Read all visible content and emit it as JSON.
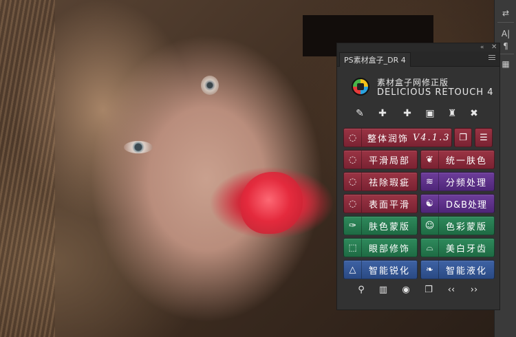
{
  "panel": {
    "tab_title": "PS素材盒子_DR 4",
    "brand_cn": "素材盒子网修正版",
    "brand_en": "DELICIOUS RETOUCH 4",
    "collapse_glyph": "«",
    "close_glyph": "✕"
  },
  "toolbar_icons": [
    "dropper-brush-icon",
    "bandage-icon",
    "bandage-2-icon",
    "chip-icon",
    "stamp-icon",
    "stamp-x-icon"
  ],
  "toolbar_glyphs": [
    "✎",
    "✚",
    "✚",
    "▣",
    "♜",
    "✖"
  ],
  "buttons": {
    "overall_skin": {
      "label": "整体润饰",
      "version": "V4.1.3",
      "icon": "lasso-icon",
      "glyph": "◌"
    },
    "smooth_local": {
      "label": "平滑局部",
      "icon": "lasso-icon",
      "glyph": "◌"
    },
    "unify_skin": {
      "label": "统一肤色",
      "icon": "leaf-icon",
      "glyph": "❦"
    },
    "remove_blemish": {
      "label": "祛除瑕疵",
      "icon": "lasso-icon",
      "glyph": "◌"
    },
    "freq_sep": {
      "label": "分频处理",
      "icon": "wave-icon",
      "glyph": "≋"
    },
    "surface_smooth": {
      "label": "表面平滑",
      "icon": "lasso-icon",
      "glyph": "◌"
    },
    "db_process": {
      "label": "D&B处理",
      "icon": "yin-yang-icon",
      "glyph": "☯"
    },
    "skin_mask": {
      "label": "肤色蒙版",
      "icon": "eyedropper-icon",
      "glyph": "✑"
    },
    "color_mask": {
      "label": "色彩蒙版",
      "icon": "masks-icon",
      "glyph": "☺"
    },
    "eye_retouch": {
      "label": "眼部修饰",
      "icon": "marquee-icon",
      "glyph": "⬚"
    },
    "teeth_whiten": {
      "label": "美白牙齿",
      "icon": "teeth-icon",
      "glyph": "⌓"
    },
    "smart_sharpen": {
      "label": "智能锐化",
      "icon": "triangle-icon",
      "glyph": "△"
    },
    "smart_liquify": {
      "label": "智能液化",
      "icon": "flame-icon",
      "glyph": "❧"
    }
  },
  "square_buttons": {
    "layers": {
      "icon": "layers-icon",
      "glyph": "❐"
    },
    "sliders": {
      "icon": "sliders-icon",
      "glyph": "☰"
    }
  },
  "bottom_icons": [
    "zoom-icon",
    "book-icon",
    "eye-view-icon",
    "copy-icon",
    "prev-icon",
    "next-icon"
  ],
  "bottom_glyphs": [
    "⚲",
    "▥",
    "◉",
    "❐",
    "‹‹",
    "››"
  ],
  "right_toolbar_glyphs": [
    "⇄",
    "A|",
    "¶",
    "▦"
  ],
  "colors": {
    "red": "#8a2b3b",
    "purple": "#5e3189",
    "green": "#27794f",
    "blue": "#345693"
  }
}
